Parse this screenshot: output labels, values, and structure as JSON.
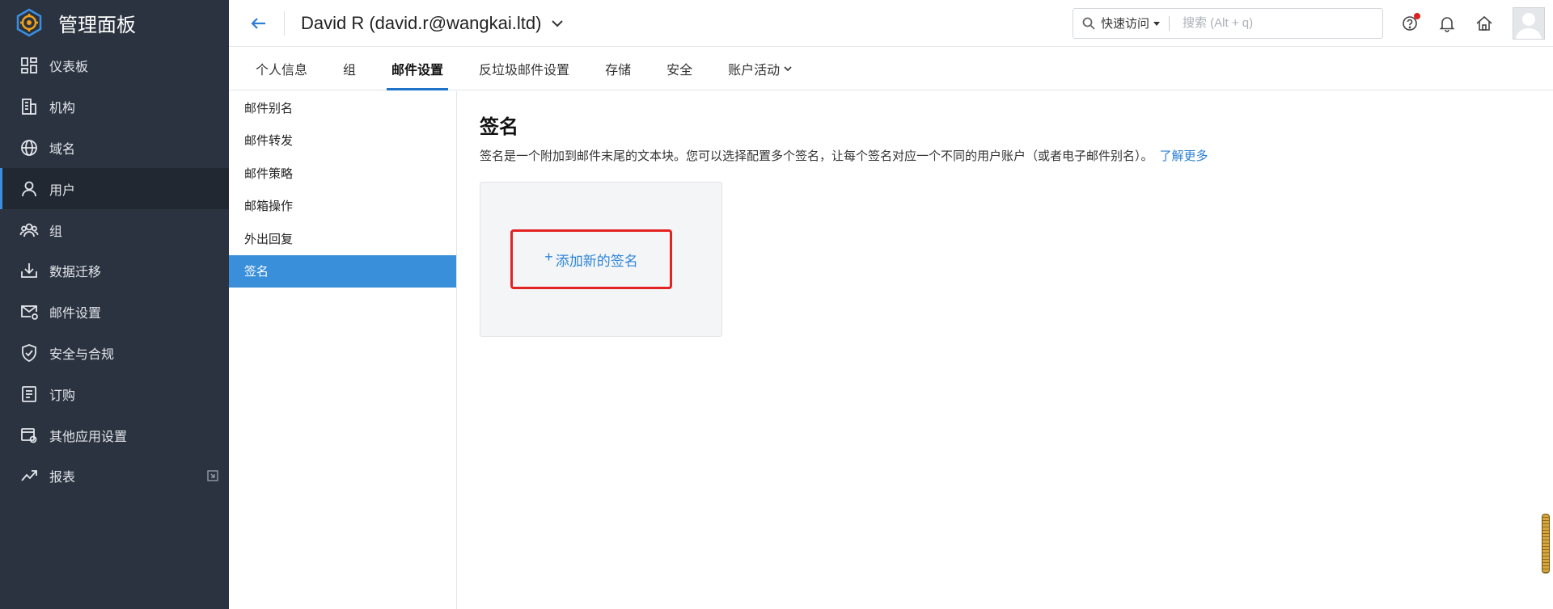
{
  "sidebar": {
    "title": "管理面板",
    "items": [
      {
        "label": "仪表板",
        "icon": "dashboard-icon"
      },
      {
        "label": "机构",
        "icon": "building-icon"
      },
      {
        "label": "域名",
        "icon": "globe-icon"
      },
      {
        "label": "用户",
        "icon": "user-icon",
        "active": true
      },
      {
        "label": "组",
        "icon": "group-icon"
      },
      {
        "label": "数据迁移",
        "icon": "download-tray-icon"
      },
      {
        "label": "邮件设置",
        "icon": "mail-gear-icon"
      },
      {
        "label": "安全与合规",
        "icon": "shield-icon"
      },
      {
        "label": "订购",
        "icon": "receipt-icon"
      },
      {
        "label": "其他应用设置",
        "icon": "app-settings-icon"
      },
      {
        "label": "报表",
        "icon": "trend-icon"
      }
    ]
  },
  "header": {
    "user_title": "David R (david.r@wangkai.ltd)",
    "quick_access": "快速访问",
    "search_placeholder": "搜索 (Alt + q)"
  },
  "tabs": [
    {
      "label": "个人信息"
    },
    {
      "label": "组"
    },
    {
      "label": "邮件设置",
      "active": true
    },
    {
      "label": "反垃圾邮件设置"
    },
    {
      "label": "存储"
    },
    {
      "label": "安全"
    },
    {
      "label": "账户活动"
    }
  ],
  "subnav": [
    {
      "label": "邮件别名"
    },
    {
      "label": "邮件转发"
    },
    {
      "label": "邮件策略"
    },
    {
      "label": "邮箱操作"
    },
    {
      "label": "外出回复"
    },
    {
      "label": "签名",
      "active": true
    }
  ],
  "content": {
    "title": "签名",
    "description": "签名是一个附加到邮件末尾的文本块。您可以选择配置多个签名，让每个签名对应一个不同的用户账户（或者电子邮件别名）。",
    "learn_more": "了解更多",
    "add_signature": "添加新的签名",
    "plus": "+"
  },
  "colors": {
    "sidebar_bg": "#2b3340",
    "accent": "#3a8fdb",
    "link": "#2a7fd4",
    "highlight_border": "#e32222"
  }
}
